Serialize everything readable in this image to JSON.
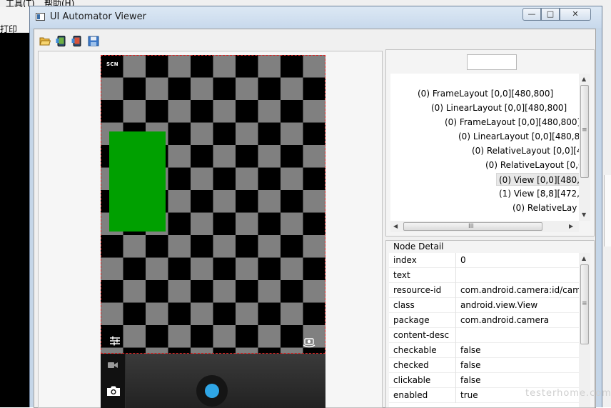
{
  "background_app": {
    "menu_tools": "工具(T)",
    "menu_help": "帮助(H)",
    "print_label": "打印"
  },
  "window": {
    "title": "UI Automator Viewer",
    "min_glyph": "—",
    "max_glyph": "□",
    "close_glyph": "✕"
  },
  "toolbar": {
    "icons": [
      "open-folder-icon",
      "device-screenshot-icon",
      "device-screenshot-compressed-icon",
      "save-icon"
    ]
  },
  "device_screen": {
    "scn_label": "SCN",
    "checker_colors": [
      "#808080",
      "#000000"
    ],
    "highlight_color": "#00a000",
    "shutter_color": "#2fa6e6"
  },
  "hierarchy": {
    "search_value": "",
    "nodes": [
      "(0) FrameLayout [0,0][480,800]",
      "(0) LinearLayout [0,0][480,800]",
      "(0) FrameLayout [0,0][480,800]",
      "(0) LinearLayout [0,0][480,80",
      "(0) RelativeLayout [0,0][4",
      "(0) RelativeLayout [0,0",
      "(0) View [0,0][480,",
      "(1) View [8,8][472,",
      "(0) RelativeLay"
    ],
    "selected_index": 6,
    "hscroll_glyph": "III",
    "vscroll_glyph": "≡"
  },
  "node_detail": {
    "title": "Node Detail",
    "rows": [
      {
        "key": "index",
        "value": "0"
      },
      {
        "key": "text",
        "value": ""
      },
      {
        "key": "resource-id",
        "value": "com.android.camera:id/cam"
      },
      {
        "key": "class",
        "value": "android.view.View"
      },
      {
        "key": "package",
        "value": "com.android.camera"
      },
      {
        "key": "content-desc",
        "value": ""
      },
      {
        "key": "checkable",
        "value": "false"
      },
      {
        "key": "checked",
        "value": "false"
      },
      {
        "key": "clickable",
        "value": "false"
      },
      {
        "key": "enabled",
        "value": "true"
      }
    ]
  },
  "watermark": "testerhome.com"
}
